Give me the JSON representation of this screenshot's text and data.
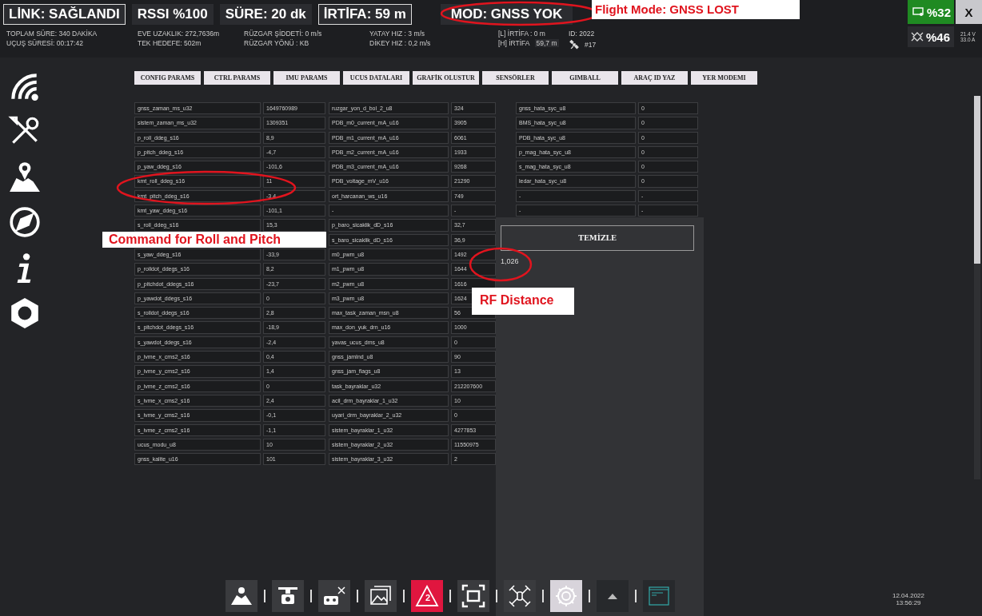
{
  "header": {
    "badges": [
      {
        "text": "LİNK: SAĞLANDI",
        "framed": true
      },
      {
        "text": "RSSI %100",
        "framed": false
      },
      {
        "text": "SÜRE: 20 dk",
        "framed": false
      },
      {
        "text": "İRTİFA: 59 m",
        "framed": true
      }
    ],
    "mode": "MOD: GNSS YOK",
    "stats": [
      [
        "TOPLAM SÜRE: 340 DAKİKA",
        "UÇUŞ SÜRESİ: 00:17:42"
      ],
      [
        "EVE UZAKLIK: 272,7636m",
        "TEK HEDEFE: 502m"
      ],
      [
        "RÜZGAR ŞİDDETİ: 0 m/s",
        "RÜZGAR YÖNÜ : KB"
      ],
      [
        "YATAY HIZ : 3 m/s",
        "DİKEY HIZ : 0,2 m/s"
      ]
    ],
    "altitude": [
      {
        "label": "[L] İRTİFA : 0 m"
      },
      {
        "label": "[H] İRTİFA",
        "value": "59,7 m"
      }
    ],
    "vehicle_id": "ID: 2022",
    "satellites": "#17",
    "screen_battery": "%32",
    "close": "X",
    "drone_battery": "%46",
    "voltage": "21.4 V",
    "current": "33.0 A"
  },
  "annotations": [
    "Flight Mode: GNSS LOST",
    "Command for Roll and Pitch",
    "RF Distance"
  ],
  "tabs": [
    {
      "label": "CONFIG PARAMS",
      "selected": false
    },
    {
      "label": "CTRL PARAMS",
      "selected": false
    },
    {
      "label": "IMU PARAMS",
      "selected": false
    },
    {
      "label": "UCUS DATALARI",
      "selected": false
    },
    {
      "label": "GRAFİK OLUSTUR",
      "selected": false
    },
    {
      "label": "SENSÖRLER",
      "selected": false
    },
    {
      "label": "GIMBALL",
      "selected": false
    },
    {
      "label": "ARAÇ ID YAZ",
      "selected": false
    },
    {
      "label": "YER MODEMI",
      "selected": false
    }
  ],
  "table": {
    "groups": [
      [
        {
          "name": "gnss_zaman_ms_u32",
          "value": "1649760989"
        },
        {
          "name": "sistem_zaman_ms_u32",
          "value": "1309351"
        },
        {
          "name": "p_roll_ddeg_s16",
          "value": "8,9"
        },
        {
          "name": "p_pitch_ddeg_s16",
          "value": "-4,7"
        },
        {
          "name": "p_yaw_ddeg_s16",
          "value": "-101,6"
        },
        {
          "name": "kmt_roll_ddeg_s16",
          "value": "11"
        },
        {
          "name": "kmt_pitch_ddeg_s16",
          "value": "-3,4"
        },
        {
          "name": "kmt_yaw_ddeg_s16",
          "value": "-101,1"
        },
        {
          "name": "s_roll_ddeg_s16",
          "value": "15,3"
        },
        {
          "name": "s_yaw_ddeg_s16",
          "value": "-33,9"
        },
        {
          "name": "p_rolldot_ddegs_s16",
          "value": "8,2"
        },
        {
          "name": "p_pitchdot_ddegs_s16",
          "value": "-23,7"
        },
        {
          "name": "p_yawdot_ddegs_s16",
          "value": "0"
        },
        {
          "name": "s_rolldot_ddegs_s16",
          "value": "2,8"
        },
        {
          "name": "s_pitchdot_ddegs_s16",
          "value": "-18,9"
        },
        {
          "name": "s_yawdot_ddegs_s16",
          "value": "-2,4"
        },
        {
          "name": "p_ivme_x_cms2_s16",
          "value": "0,4"
        },
        {
          "name": "p_ivme_y_cms2_s16",
          "value": "1,4"
        },
        {
          "name": "p_ivme_z_cms2_s16",
          "value": "0"
        },
        {
          "name": "s_ivme_x_cms2_s16",
          "value": "2,4"
        },
        {
          "name": "s_ivme_y_cms2_s16",
          "value": "-0,1"
        },
        {
          "name": "s_ivme_z_cms2_s16",
          "value": "-1,1"
        },
        {
          "name": "ucus_modu_u8",
          "value": "10"
        },
        {
          "name": "gnss_kalite_u16",
          "value": "101"
        }
      ],
      [
        {
          "name": "ruzgar_yon_d_bol_2_u8",
          "value": "324"
        },
        {
          "name": "PDB_m0_current_mA_u16",
          "value": "3905"
        },
        {
          "name": "PDB_m1_current_mA_u16",
          "value": "6061"
        },
        {
          "name": "PDB_m2_current_mA_u16",
          "value": "1933"
        },
        {
          "name": "PDB_m3_current_mA_u16",
          "value": "9268"
        },
        {
          "name": "PDB_voltage_mV_u16",
          "value": "21290"
        },
        {
          "name": "ort_harcanan_ws_u16",
          "value": "749"
        },
        {
          "name": "-",
          "value": "-"
        },
        {
          "name": "p_baro_sicaklik_dD_s16",
          "value": "32,7"
        },
        {
          "name": "s_baro_sicaklik_dD_s16",
          "value": "36,9"
        },
        {
          "name": "m0_pwm_u8",
          "value": "1492"
        },
        {
          "name": "m1_pwm_u8",
          "value": "1644"
        },
        {
          "name": "m2_pwm_u8",
          "value": "1616"
        },
        {
          "name": "m3_pwm_u8",
          "value": "1624"
        },
        {
          "name": "max_task_zaman_msn_u8",
          "value": "56"
        },
        {
          "name": "max_don_yuk_drn_u16",
          "value": "1000"
        },
        {
          "name": "yavas_ucus_dms_u8",
          "value": "0"
        },
        {
          "name": "gnss_jamInd_u8",
          "value": "90"
        },
        {
          "name": "gnss_jam_flags_u8",
          "value": "13"
        },
        {
          "name": "task_bayraklar_u32",
          "value": "212207600"
        },
        {
          "name": "acil_drm_bayraklar_1_u32",
          "value": "10"
        },
        {
          "name": "uyari_drm_bayraklar_2_u32",
          "value": "0"
        },
        {
          "name": "sistem_bayraklar_1_u32",
          "value": "4277853"
        },
        {
          "name": "sistem_bayraklar_2_u32",
          "value": "11550975"
        },
        {
          "name": "sistem_bayraklar_3_u32",
          "value": "2"
        }
      ],
      [
        {
          "name": "gnss_hata_syc_u8",
          "value": "0"
        },
        {
          "name": "BMS_hata_syc_u8",
          "value": "0"
        },
        {
          "name": "PDB_hata_syc_u8",
          "value": "0"
        },
        {
          "name": "p_mag_hata_syc_u8",
          "value": "0"
        },
        {
          "name": "s_mag_hata_syc_u8",
          "value": "0"
        },
        {
          "name": "ledar_hata_syc_u8",
          "value": "0"
        },
        {
          "name": "-",
          "value": "-"
        },
        {
          "name": "-",
          "value": "-"
        }
      ]
    ]
  },
  "panel": {
    "button": "TEMİZLE",
    "value": "1,026"
  },
  "toolbar": [
    {
      "kind": "map",
      "selected": false
    },
    {
      "kind": "camera-drone",
      "selected": false
    },
    {
      "kind": "controller",
      "selected": false
    },
    {
      "kind": "gallery",
      "selected": false
    },
    {
      "kind": "alert",
      "selected": false,
      "badge": "2"
    },
    {
      "kind": "frame",
      "selected": false
    },
    {
      "kind": "drone",
      "selected": false
    },
    {
      "kind": "gear",
      "selected": true
    },
    {
      "kind": "up",
      "selected": false
    },
    {
      "kind": "terminal",
      "selected": false
    }
  ],
  "clock": {
    "date": "12.04.2022",
    "time": "13:56:29"
  }
}
